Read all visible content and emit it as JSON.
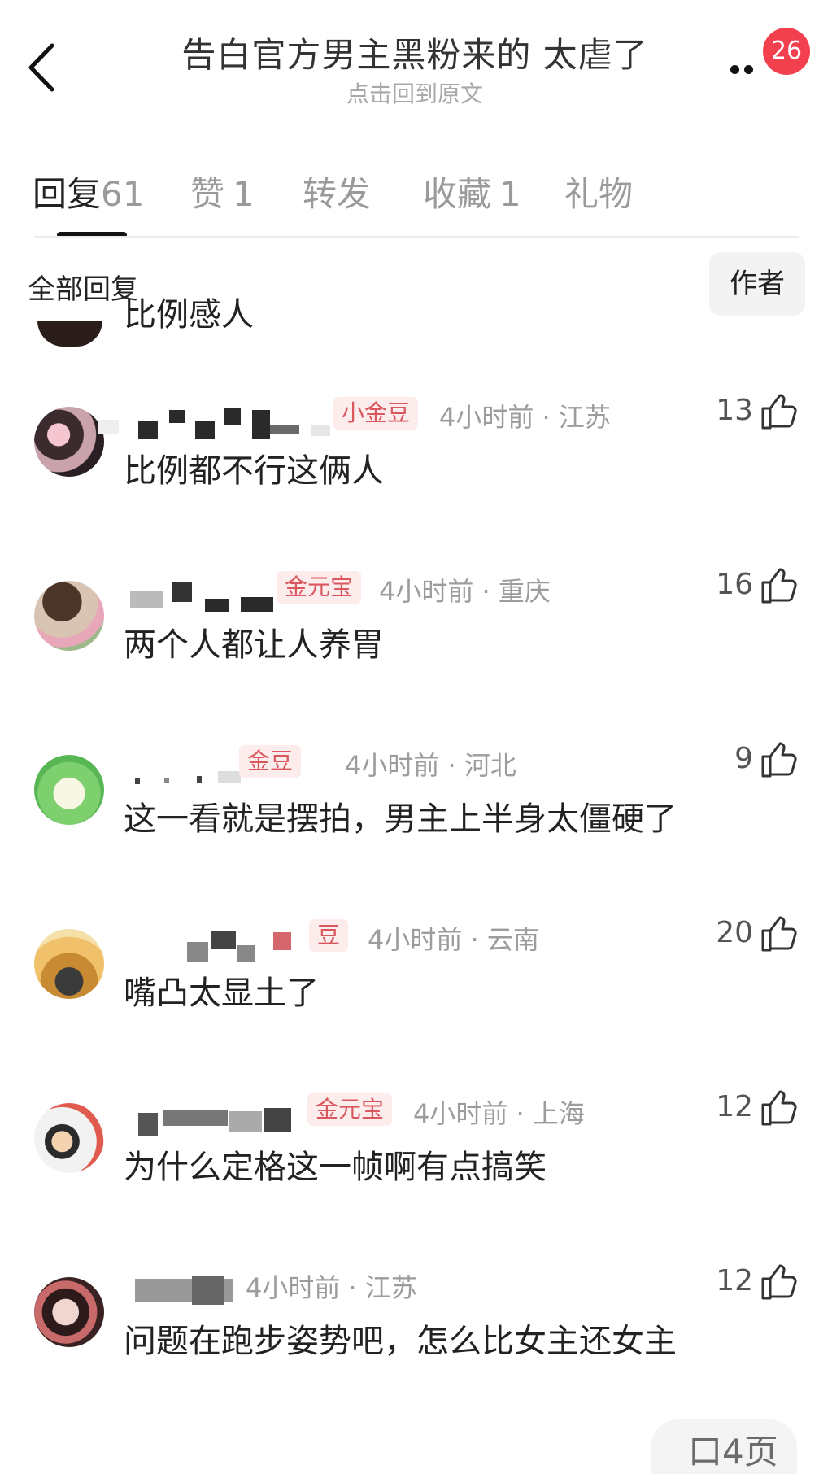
{
  "header": {
    "title": "告白官方男主黑粉来的  太虐了",
    "subtitle": "点击回到原文",
    "notification_count": "26"
  },
  "tabs": [
    {
      "label": "回复",
      "count": "61",
      "active": true
    },
    {
      "label": "赞",
      "count": "1",
      "active": false
    },
    {
      "label": "转发",
      "count": "",
      "active": false
    },
    {
      "label": "收藏",
      "count": "1",
      "active": false
    },
    {
      "label": "礼物",
      "count": "",
      "active": false
    }
  ],
  "filter": {
    "label": "全部回复",
    "author_button": "作者"
  },
  "partial_comment": {
    "text": "比例感人"
  },
  "comments": [
    {
      "tag": "小金豆",
      "time": "4小时前",
      "location": "江苏",
      "likes": "13",
      "text": "比例都不行这俩人"
    },
    {
      "tag": "金元宝",
      "time": "4小时前",
      "location": "重庆",
      "likes": "16",
      "text": "两个人都让人养胃"
    },
    {
      "tag": "金豆",
      "time": "4小时前",
      "location": "河北",
      "likes": "9",
      "text": "这一看就是摆拍，男主上半身太僵硬了"
    },
    {
      "tag": "豆",
      "time": "4小时前",
      "location": "云南",
      "likes": "20",
      "text": "嘴凸太显土了"
    },
    {
      "tag": "金元宝",
      "time": "4小时前",
      "location": "上海",
      "likes": "12",
      "text": "为什么定格这一帧啊有点搞笑"
    },
    {
      "tag": "",
      "time": "4小时前",
      "location": "江苏",
      "likes": "12",
      "text": "问题在跑步姿势吧，怎么比女主还女主"
    }
  ],
  "floating_button": {
    "label": "口4页"
  },
  "colors": {
    "accent_red": "#f2404f",
    "tag_text": "#d9575e",
    "tag_bg": "#fdecec",
    "meta_gray": "#9c9c9c"
  }
}
